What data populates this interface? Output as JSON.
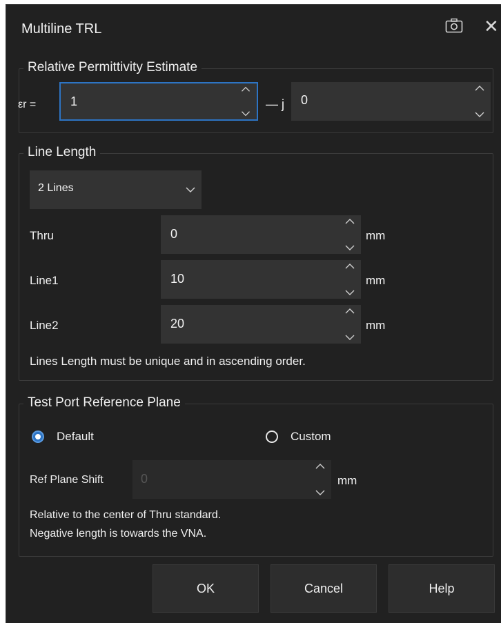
{
  "dialog": {
    "title": "Multiline TRL"
  },
  "permittivity": {
    "legend": "Relative Permittivity Estimate",
    "er_label": "εr =",
    "er_real": "1",
    "minus_j": "— j",
    "er_imag": "0"
  },
  "line_length": {
    "legend": "Line Length",
    "lines_select": "2 Lines",
    "rows": [
      {
        "label": "Thru",
        "value": "0",
        "unit": "mm"
      },
      {
        "label": "Line1",
        "value": "10",
        "unit": "mm"
      },
      {
        "label": "Line2",
        "value": "20",
        "unit": "mm"
      }
    ],
    "note": "Lines Length must be unique and in ascending order."
  },
  "reference_plane": {
    "legend": "Test Port Reference Plane",
    "default_label": "Default",
    "custom_label": "Custom",
    "selected": "Default",
    "shift_label": "Ref Plane Shift",
    "shift_value": "0",
    "shift_unit": "mm",
    "note_line1": "Relative to the center of Thru standard.",
    "note_line2": "Negative length is towards the VNA."
  },
  "buttons": {
    "ok": "OK",
    "cancel": "Cancel",
    "help": "Help"
  },
  "colors": {
    "background": "#212121",
    "field": "#333333",
    "focus": "#2d74c4",
    "text": "#f0f0f0"
  }
}
